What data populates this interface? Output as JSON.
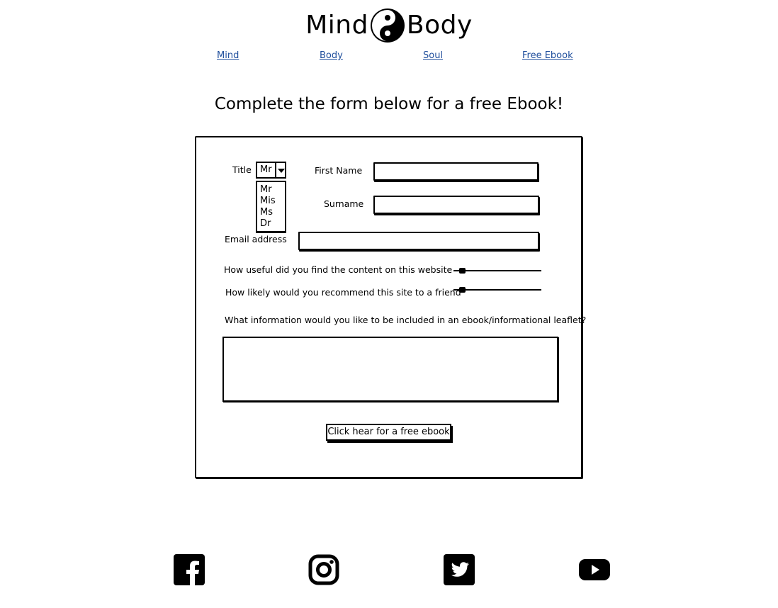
{
  "brand": {
    "left": "Mind",
    "right": "Body",
    "logo_icon": "yin-yang-icon"
  },
  "nav": {
    "items": [
      "Mind",
      "Body",
      "Soul",
      "Free Ebook"
    ]
  },
  "headline": "Complete the form below for a free Ebook!",
  "form": {
    "title_label": "Title",
    "title_selected": "Mr",
    "title_options": [
      "Mr",
      "Mis",
      "Ms",
      "Dr"
    ],
    "first_name_label": "First Name",
    "surname_label": "Surname",
    "email_label": "Email address",
    "useful_label": "How useful did you find the content on this website",
    "useful_value": 0.1,
    "recommend_label": "How likely would you recommend this site to a friend",
    "recommend_value": 0.1,
    "info_label": "What information would you like to be included in an ebook/informational leaflet?",
    "submit_label": "Click hear for a free ebook"
  },
  "social": [
    "facebook-icon",
    "instagram-icon",
    "twitter-icon",
    "youtube-icon"
  ]
}
